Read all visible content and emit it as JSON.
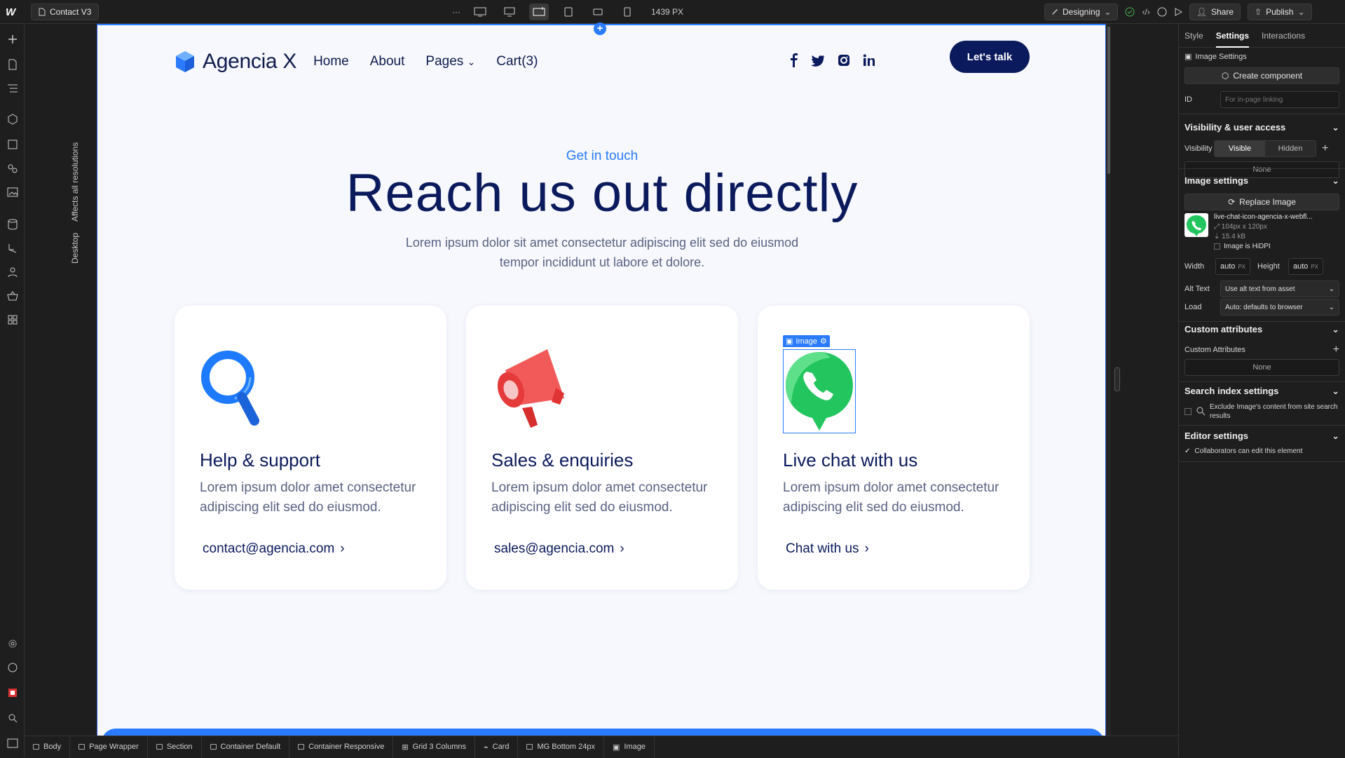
{
  "topbar": {
    "logo": "W",
    "page_name": "Contact V3",
    "more": "···",
    "width_label": "1439 PX",
    "mode": "Designing",
    "share": "Share",
    "publish": "Publish"
  },
  "canvas_side": {
    "affects": "Affects all resolutions",
    "breakpoint": "Desktop"
  },
  "site": {
    "brand": "Agencia X",
    "nav": [
      "Home",
      "About",
      "Pages",
      "Cart(3)"
    ],
    "cta": "Let's talk",
    "eyebrow": "Get in touch",
    "headline": "Reach us out directly",
    "subtext": "Lorem ipsum dolor sit amet consectetur adipiscing elit sed do eiusmod tempor incididunt ut labore et dolore.",
    "cards": [
      {
        "title": "Help & support",
        "desc": "Lorem ipsum dolor amet consectetur adipiscing elit sed do eiusmod.",
        "link": "contact@agencia.com"
      },
      {
        "title": "Sales & enquiries",
        "desc": "Lorem ipsum dolor amet consectetur adipiscing elit sed do eiusmod.",
        "link": "sales@agencia.com"
      },
      {
        "title": "Live chat with us",
        "desc": "Lorem ipsum dolor amet consectetur adipiscing elit sed do eiusmod.",
        "link": "Chat with us"
      }
    ],
    "selected_tag": "Image"
  },
  "panel": {
    "tabs": [
      "Style",
      "Settings",
      "Interactions"
    ],
    "image_settings_label": "Image Settings",
    "create_component": "Create component",
    "id_label": "ID",
    "id_placeholder": "For in-page linking",
    "visibility_section": "Visibility & user access",
    "visibility_label": "Visibility",
    "visible": "Visible",
    "hidden": "Hidden",
    "none": "None",
    "image_section": "Image settings",
    "replace_image": "Replace Image",
    "file_name": "live-chat-icon-agencia-x-webfl...",
    "file_dims": "104px x 120px",
    "file_size": "15.4 kB",
    "hidpi": "Image is HiDPI",
    "width_label": "Width",
    "width_val": "auto",
    "height_label": "Height",
    "height_val": "auto",
    "unit": "PX",
    "alt_label": "Alt Text",
    "alt_val": "Use alt text from asset",
    "load_label": "Load",
    "load_val": "Auto: defaults to browser",
    "custom_section": "Custom attributes",
    "custom_label": "Custom Attributes",
    "search_section": "Search index settings",
    "search_exclude": "Exclude Image's content from site search results",
    "editor_section": "Editor settings",
    "editor_collab": "Collaborators can edit this element"
  },
  "breadcrumbs": [
    "Body",
    "Page Wrapper",
    "Section",
    "Container Default",
    "Container Responsive",
    "Grid 3 Columns",
    "Card",
    "MG Bottom 24px",
    "Image"
  ],
  "colors": {
    "brand_navy": "#0b1a5c",
    "accent_blue": "#2a7bff",
    "whatsapp_green": "#25d366"
  }
}
